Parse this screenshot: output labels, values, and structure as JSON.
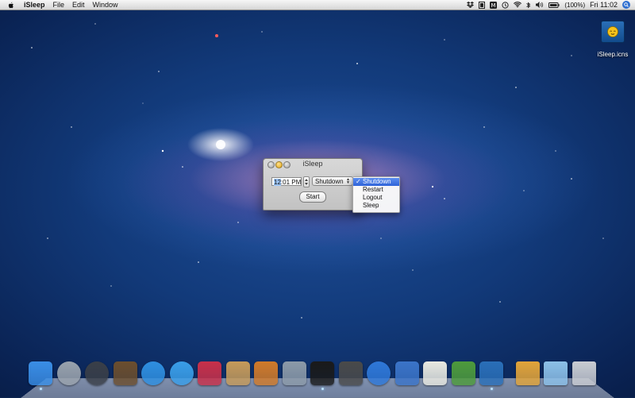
{
  "menubar": {
    "app_name": "iSleep",
    "menus": [
      "File",
      "Edit",
      "Window"
    ],
    "battery": "(100%)",
    "clock": "Fri 11:02"
  },
  "desktop": {
    "icon_label": "iSleep.icns"
  },
  "window": {
    "title": "iSleep",
    "time_hour": "12",
    "time_rest": ":01 PM",
    "action_selected": "Shutdown",
    "start_label": "Start"
  },
  "dropdown": {
    "items": [
      "Shutdown",
      "Restart",
      "Logout",
      "Sleep"
    ],
    "selected_index": 0,
    "check": "✓"
  },
  "dock": {
    "icons": [
      {
        "name": "finder-icon",
        "color": "#3a8ee6"
      },
      {
        "name": "launchpad-icon",
        "color": "#9aa3ad"
      },
      {
        "name": "dashboard-icon",
        "color": "#3a3f48"
      },
      {
        "name": "mission-control-icon",
        "color": "#6b4e2e"
      },
      {
        "name": "app-store-icon",
        "color": "#2f8fe0"
      },
      {
        "name": "safari-icon",
        "color": "#3a9ee8"
      },
      {
        "name": "photo-booth-icon",
        "color": "#c8304a"
      },
      {
        "name": "iphoto-icon",
        "color": "#c59a5a"
      },
      {
        "name": "photo-gallery-icon",
        "color": "#d07a2a"
      },
      {
        "name": "automator-icon",
        "color": "#8c9aa8"
      },
      {
        "name": "developer-app-icon",
        "color": "#1a1a1a"
      },
      {
        "name": "imovie-icon",
        "color": "#4a4a4a"
      },
      {
        "name": "itunes-icon",
        "color": "#2f78d8"
      },
      {
        "name": "xcode-icon",
        "color": "#3b74c8"
      },
      {
        "name": "text-edit-icon",
        "color": "#e8e8e0"
      },
      {
        "name": "charts-app-icon",
        "color": "#4e9b3c"
      },
      {
        "name": "isleep-dock-icon",
        "color": "#2a6fb8"
      },
      {
        "name": "package-icon",
        "color": "#e2a43a"
      },
      {
        "name": "downloads-folder-icon",
        "color": "#8cc0e8"
      },
      {
        "name": "trash-icon",
        "color": "#c9ccd2"
      }
    ]
  }
}
